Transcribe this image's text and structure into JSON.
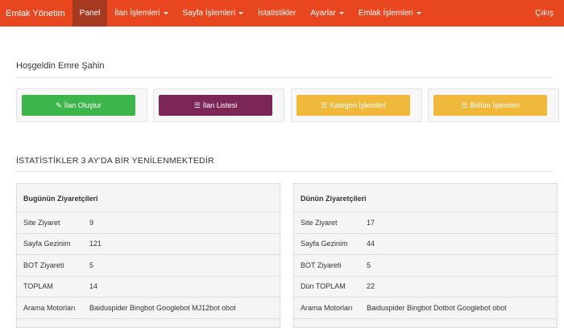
{
  "nav": {
    "brand": "Emlak Yönetim",
    "items": [
      {
        "label": "Panel"
      },
      {
        "label": "İlan İşlemleri"
      },
      {
        "label": "Sayfa İşlemleri"
      },
      {
        "label": "İstatistikler"
      },
      {
        "label": "Ayarlar"
      },
      {
        "label": "Emlak İşlemleri"
      }
    ],
    "logout": "Çıkış"
  },
  "welcome": "Hoşgeldin Emre Şahin",
  "actions": [
    {
      "label": "İlan Oluştur",
      "icon": "edit-icon",
      "color": "#3cb54a"
    },
    {
      "label": "İlan Listesi",
      "icon": "list-icon",
      "color": "#7c2655"
    },
    {
      "label": "Kategori İşlemleri",
      "icon": "list-icon",
      "color": "#f0b93b"
    },
    {
      "label": "Bölüm İşlemleri",
      "icon": "list-icon",
      "color": "#f0b93b"
    }
  ],
  "stats_title": "İSTATİSTİKLER 3 AY'DA BİR YENİLENMEKTEDİR",
  "today": {
    "title": "Bugünün Ziyaretçileri",
    "rows": [
      {
        "label": "Site Ziyaret",
        "value": "9"
      },
      {
        "label": "Sayfa Gezinim",
        "value": "121"
      },
      {
        "label": "BOT Ziyareti",
        "value": "5"
      },
      {
        "label": "TOPLAM",
        "value": "14"
      },
      {
        "label": "Arama Motorları",
        "value": "Baiduspider Bingbot Googlebot MJ12bot obot"
      }
    ]
  },
  "yesterday": {
    "title": "Dünün Ziyaretçileri",
    "rows": [
      {
        "label": "Site Ziyaret",
        "value": "17"
      },
      {
        "label": "Sayfa Gezinim",
        "value": "44"
      },
      {
        "label": "BOT Ziyareti",
        "value": "5"
      },
      {
        "label": "Dün TOPLAM",
        "value": "22"
      },
      {
        "label": "Arama Motorları",
        "value": "Baiduspider Bingbot Dotbot Googlebot obot"
      }
    ]
  }
}
